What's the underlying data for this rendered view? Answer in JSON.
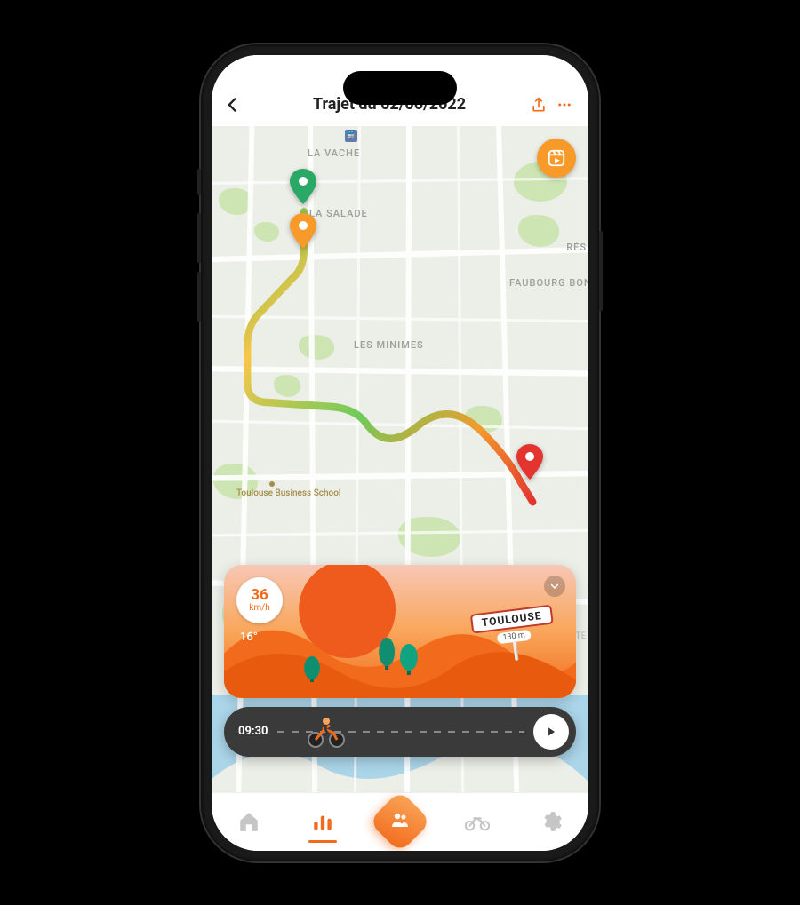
{
  "header": {
    "title": "Trajet du 02/06/2022",
    "back_icon": "chevron-left",
    "share_icon": "share",
    "more_icon": "ellipsis"
  },
  "map": {
    "neighborhoods": [
      "LA VACHE",
      "LA SALADE",
      "LES MINIMES",
      "FAUBOURG BONNEFOY",
      "RÉS",
      "CÔTE"
    ],
    "poi": {
      "name": "Toulouse Business School"
    },
    "pins": {
      "start": "green",
      "checkpoint": "orange",
      "end": "red"
    },
    "video_button": "play-reel"
  },
  "info_card": {
    "speed_value": "36",
    "speed_unit": "km/h",
    "temperature": "16°",
    "city": "TOULOUSE",
    "distance": "130 m"
  },
  "timeline": {
    "time": "09:30",
    "play_icon": "play"
  },
  "nav": {
    "items": [
      {
        "name": "home-icon"
      },
      {
        "name": "stats-icon",
        "active": true
      },
      {
        "name": "social-icon",
        "center": true
      },
      {
        "name": "moto-icon"
      },
      {
        "name": "settings-icon"
      }
    ]
  },
  "colors": {
    "accent": "#f26a1b",
    "accent_light": "#f9a65a",
    "green": "#2aa866",
    "red": "#e3342f"
  }
}
